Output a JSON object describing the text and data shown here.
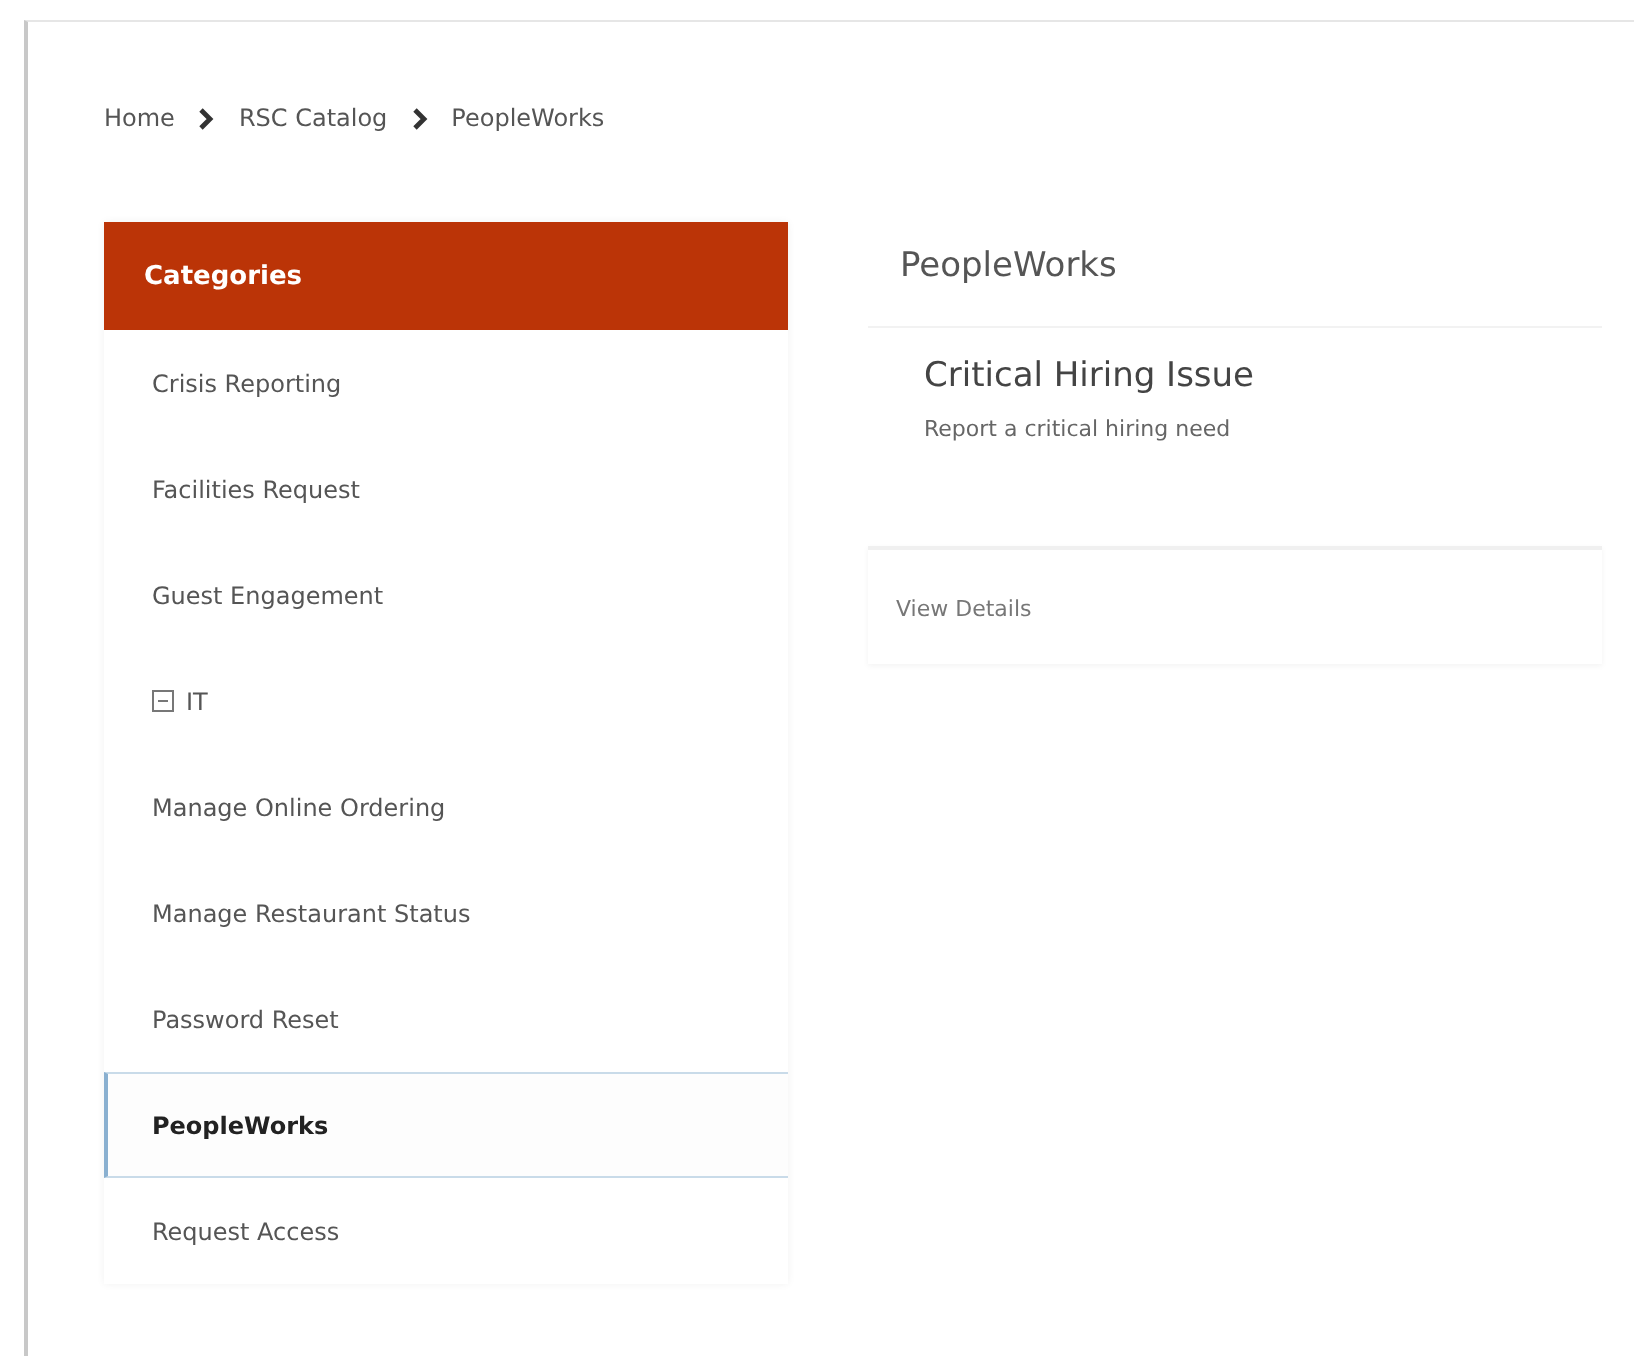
{
  "breadcrumb": [
    "Home",
    "RSC Catalog",
    "PeopleWorks"
  ],
  "sidebar": {
    "title": "Categories",
    "items": [
      {
        "label": "Crisis Reporting",
        "kind": "plain",
        "selected": false
      },
      {
        "label": "Facilities Request",
        "kind": "plain",
        "selected": false
      },
      {
        "label": "Guest Engagement",
        "kind": "plain",
        "selected": false
      },
      {
        "label": "IT",
        "kind": "group",
        "expanded": true,
        "selected": false
      },
      {
        "label": "Manage Online Ordering",
        "kind": "plain",
        "selected": false
      },
      {
        "label": "Manage Restaurant Status",
        "kind": "plain",
        "selected": false
      },
      {
        "label": "Password Reset",
        "kind": "plain",
        "selected": false
      },
      {
        "label": "PeopleWorks",
        "kind": "plain",
        "selected": true
      },
      {
        "label": "Request Access",
        "kind": "plain",
        "selected": false
      }
    ]
  },
  "content": {
    "title": "PeopleWorks",
    "items": [
      {
        "title": "Critical Hiring Issue",
        "description": "Report a critical hiring need",
        "link": "View Details"
      }
    ]
  }
}
